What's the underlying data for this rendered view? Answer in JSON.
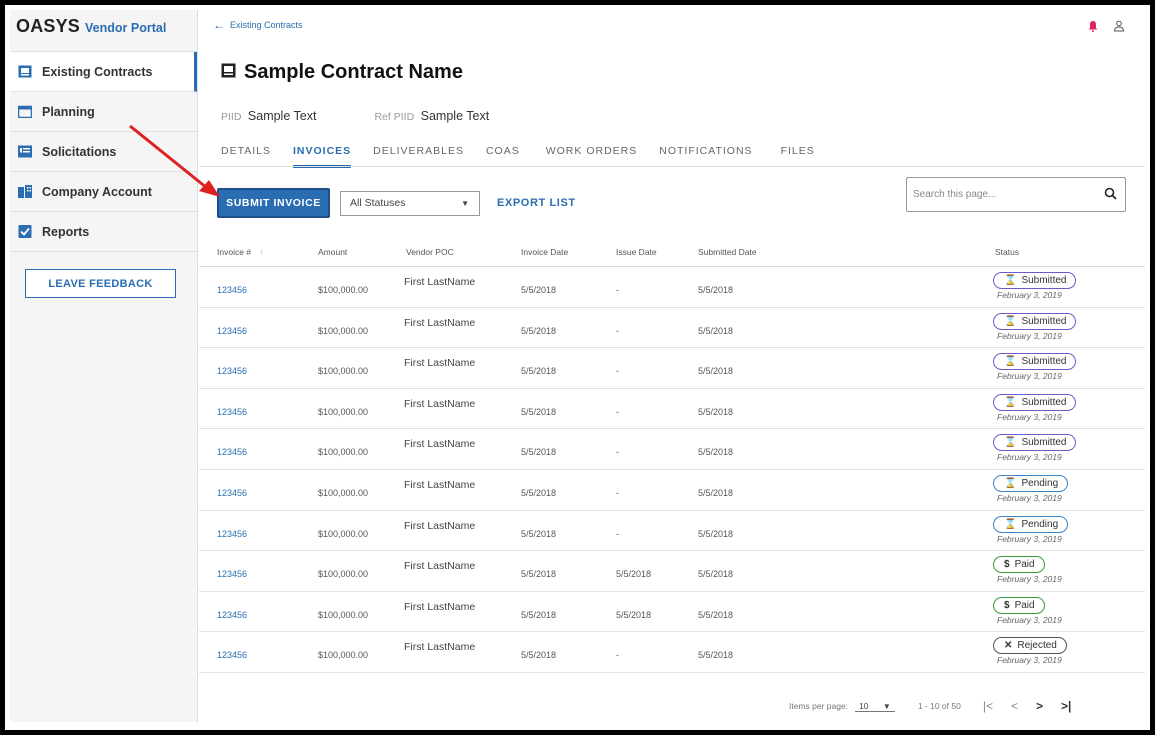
{
  "brand": {
    "main": "OASYS",
    "sub": "Vendor Portal"
  },
  "sidebar": {
    "items": [
      {
        "label": "Existing Contracts",
        "icon": "contract-icon",
        "active": true
      },
      {
        "label": "Planning",
        "icon": "calendar-icon"
      },
      {
        "label": "Solicitations",
        "icon": "solicitations-icon"
      },
      {
        "label": "Company Account",
        "icon": "building-icon"
      },
      {
        "label": "Reports",
        "icon": "checkbox-icon"
      }
    ],
    "feedback_label": "LEAVE FEEDBACK"
  },
  "breadcrumb": {
    "label": "Existing Contracts"
  },
  "header": {
    "title": "Sample Contract Name",
    "piid_label": "PIID",
    "piid_value": "Sample Text",
    "ref_label": "Ref PIID",
    "ref_value": "Sample Text"
  },
  "tabs": [
    "DETAILS",
    "INVOICES",
    "DELIVERABLES",
    "COAS",
    "WORK ORDERS",
    "NOTIFICATIONS",
    "FILES"
  ],
  "toolbar": {
    "submit_label": "SUBMIT INVOICE",
    "status_select": "All Statuses",
    "export_label": "EXPORT LIST",
    "search_placeholder": "Search this page..."
  },
  "table": {
    "columns": [
      "Invoice #",
      "Amount",
      "Vendor POC",
      "Invoice Date",
      "Issue Date",
      "Submitted Date",
      "Status"
    ],
    "sort_indicator": "↑",
    "rows": [
      {
        "invoice": "123456",
        "amount": "$100,000.00",
        "poc": "First LastName",
        "invoice_date": "5/5/2018",
        "issue_date": "-",
        "submitted": "5/5/2018",
        "status": "Submitted",
        "status_icon": "⌛",
        "status_date": "February 3, 2019"
      },
      {
        "invoice": "123456",
        "amount": "$100,000.00",
        "poc": "First LastName",
        "invoice_date": "5/5/2018",
        "issue_date": "-",
        "submitted": "5/5/2018",
        "status": "Submitted",
        "status_icon": "⌛",
        "status_date": "February 3, 2019"
      },
      {
        "invoice": "123456",
        "amount": "$100,000.00",
        "poc": "First LastName",
        "invoice_date": "5/5/2018",
        "issue_date": "-",
        "submitted": "5/5/2018",
        "status": "Submitted",
        "status_icon": "⌛",
        "status_date": "February 3, 2019"
      },
      {
        "invoice": "123456",
        "amount": "$100,000.00",
        "poc": "First LastName",
        "invoice_date": "5/5/2018",
        "issue_date": "-",
        "submitted": "5/5/2018",
        "status": "Submitted",
        "status_icon": "⌛",
        "status_date": "February 3, 2019"
      },
      {
        "invoice": "123456",
        "amount": "$100,000.00",
        "poc": "First LastName",
        "invoice_date": "5/5/2018",
        "issue_date": "-",
        "submitted": "5/5/2018",
        "status": "Submitted",
        "status_icon": "⌛",
        "status_date": "February 3, 2019"
      },
      {
        "invoice": "123456",
        "amount": "$100,000.00",
        "poc": "First LastName",
        "invoice_date": "5/5/2018",
        "issue_date": "-",
        "submitted": "5/5/2018",
        "status": "Pending",
        "status_icon": "⌛",
        "status_date": "February 3, 2019"
      },
      {
        "invoice": "123456",
        "amount": "$100,000.00",
        "poc": "First LastName",
        "invoice_date": "5/5/2018",
        "issue_date": "-",
        "submitted": "5/5/2018",
        "status": "Pending",
        "status_icon": "⌛",
        "status_date": "February 3, 2019"
      },
      {
        "invoice": "123456",
        "amount": "$100,000.00",
        "poc": "First LastName",
        "invoice_date": "5/5/2018",
        "issue_date": "5/5/2018",
        "submitted": "5/5/2018",
        "status": "Paid",
        "status_icon": "$",
        "status_date": "February 3, 2019"
      },
      {
        "invoice": "123456",
        "amount": "$100,000.00",
        "poc": "First LastName",
        "invoice_date": "5/5/2018",
        "issue_date": "5/5/2018",
        "submitted": "5/5/2018",
        "status": "Paid",
        "status_icon": "$",
        "status_date": "February 3, 2019"
      },
      {
        "invoice": "123456",
        "amount": "$100,000.00",
        "poc": "First LastName",
        "invoice_date": "5/5/2018",
        "issue_date": "-",
        "submitted": "5/5/2018",
        "status": "Rejected",
        "status_icon": "✕",
        "status_date": "February 3, 2019"
      }
    ]
  },
  "status_colors": {
    "Submitted": "#6a5acd",
    "Pending": "#3b82c4",
    "Paid": "#3a9a3a",
    "Rejected": "#555555"
  },
  "pager": {
    "items_label": "Items per page:",
    "items_value": "10",
    "range": "1 - 10 of 50",
    "first": "|<",
    "prev": "<",
    "next": ">",
    "last": ">|"
  },
  "colors": {
    "accent": "#2a6db0",
    "alert": "#e0245e",
    "annotation": "#e02020"
  }
}
